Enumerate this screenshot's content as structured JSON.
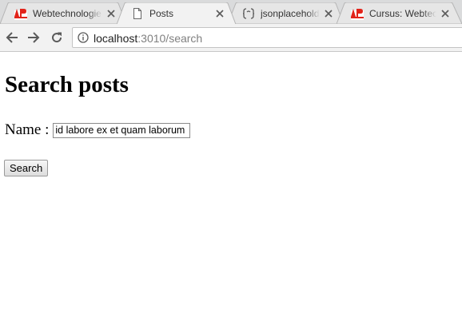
{
  "browser": {
    "tabs": [
      {
        "title": "Webtechnologie",
        "favicon": "ap-logo-icon",
        "active": false
      },
      {
        "title": "Posts",
        "favicon": "document-icon",
        "active": true
      },
      {
        "title": "jsonplaceholder",
        "favicon": "braces-icon",
        "active": false
      },
      {
        "title": "Cursus: Webtechnologie",
        "favicon": "ap-logo-icon",
        "active": false
      }
    ],
    "address": {
      "host": "localhost",
      "path": ":3010/search"
    },
    "nav_icons": [
      "back-arrow-icon",
      "forward-arrow-icon",
      "reload-icon",
      "info-icon"
    ]
  },
  "page": {
    "heading": "Search posts",
    "name_label": "Name :",
    "name_value": "id labore ex et quam laborum",
    "search_button": "Search"
  },
  "colors": {
    "tabstrip": "#dadbdc",
    "toolbar": "#f2f2f2",
    "ap_logo": "#e2231a"
  }
}
